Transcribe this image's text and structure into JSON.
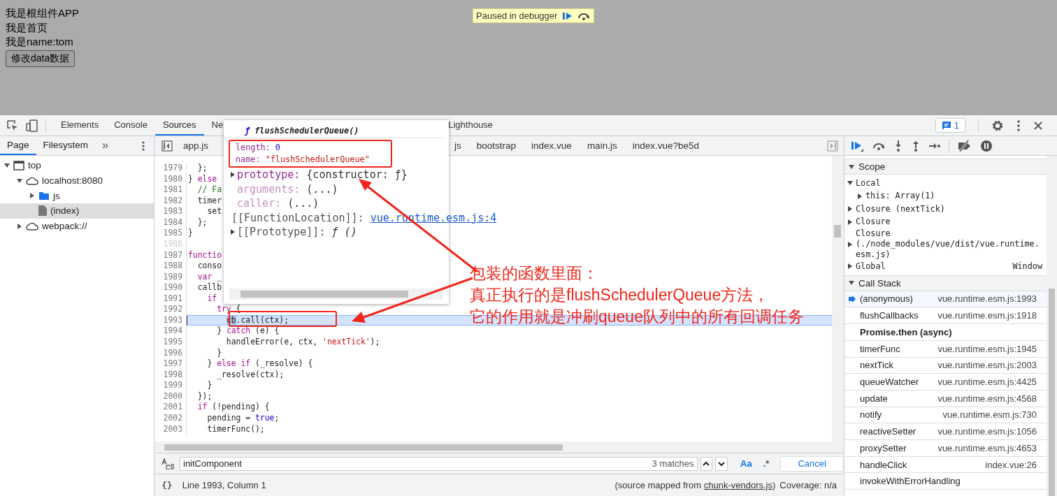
{
  "page": {
    "lines": [
      "我是根组件APP",
      "我是首页",
      "我是name:tom"
    ],
    "button": "修改data数据",
    "paused_badge": "Paused in debugger"
  },
  "devtools": {
    "tabs": [
      {
        "label": "Elements",
        "selected": false
      },
      {
        "label": "Console",
        "selected": false
      },
      {
        "label": "Sources",
        "selected": true
      },
      {
        "label": "Ne",
        "selected": false
      },
      {
        "label": "Lighthouse",
        "selected": false
      }
    ],
    "issues_count": "1",
    "navigator": {
      "tabs": [
        {
          "label": "Page",
          "selected": true
        },
        {
          "label": "Filesystem",
          "selected": false
        }
      ],
      "more": "»",
      "tree": [
        {
          "label": "top",
          "kind": "frame",
          "expanded": true,
          "selected": false,
          "children": [
            {
              "label": "localhost:8080",
              "kind": "cloud",
              "expanded": true,
              "selected": false,
              "children": [
                {
                  "label": "js",
                  "kind": "folder",
                  "expanded": false,
                  "selected": false
                },
                {
                  "label": "(index)",
                  "kind": "file",
                  "selected": true
                }
              ]
            },
            {
              "label": "webpack://",
              "kind": "cloud",
              "expanded": false,
              "selected": false
            }
          ]
        }
      ]
    },
    "file_tabs": [
      {
        "label": "app.js"
      },
      {
        "label": "js"
      },
      {
        "label": "bootstrap"
      },
      {
        "label": "index.vue"
      },
      {
        "label": "main.js"
      },
      {
        "label": "index.vue?be5d"
      }
    ],
    "code": [
      {
        "number": "1979",
        "paused": false,
        "tokens": [
          {
            "text": "  };",
            "kind": "plain"
          }
        ]
      },
      {
        "number": "1980",
        "paused": false,
        "tokens": [
          {
            "text": "} ",
            "kind": "plain"
          },
          {
            "text": "else",
            "kind": "keyword"
          }
        ]
      },
      {
        "number": "1981",
        "paused": false,
        "tokens": [
          {
            "text": "  // Fa",
            "kind": "comment"
          }
        ]
      },
      {
        "number": "1982",
        "paused": false,
        "tokens": [
          {
            "text": "  timer",
            "kind": "plain"
          }
        ]
      },
      {
        "number": "1983",
        "paused": false,
        "tokens": [
          {
            "text": "    set",
            "kind": "plain"
          }
        ]
      },
      {
        "number": "1984",
        "paused": false,
        "tokens": [
          {
            "text": "  };",
            "kind": "plain"
          }
        ]
      },
      {
        "number": "1985",
        "paused": false,
        "tokens": [
          {
            "text": "}",
            "kind": "plain"
          }
        ]
      },
      {
        "number": "1986",
        "paused": false
      },
      {
        "number": "1987",
        "paused": false,
        "tokens": [
          {
            "text": "functio",
            "kind": "keyword"
          }
        ]
      },
      {
        "number": "1988",
        "paused": false,
        "tokens": [
          {
            "text": "  conso",
            "kind": "plain"
          }
        ]
      },
      {
        "number": "1989",
        "paused": false,
        "tokens": [
          {
            "text": "  var",
            "kind": "keyword"
          },
          {
            "text": " _",
            "kind": "plain"
          }
        ]
      },
      {
        "number": "1990",
        "paused": false,
        "tokens": [
          {
            "text": "  callb",
            "kind": "plain"
          }
        ]
      },
      {
        "number": "1991",
        "paused": false,
        "tokens": [
          {
            "text": "    if",
            "kind": "keyword"
          }
        ]
      },
      {
        "number": "1992",
        "paused": false,
        "tokens": [
          {
            "text": "      try",
            "kind": "keyword"
          },
          {
            "text": " {",
            "kind": "plain"
          }
        ]
      },
      {
        "number": "1993",
        "paused": true,
        "tokens": [
          {
            "text": "        cb",
            "kind": "selection"
          },
          {
            "text": ".call(ctx);",
            "kind": "plain"
          }
        ]
      },
      {
        "number": "1994",
        "paused": false,
        "tokens": [
          {
            "text": "      } ",
            "kind": "plain"
          },
          {
            "text": "catch",
            "kind": "keyword"
          },
          {
            "text": " (e) {",
            "kind": "plain"
          }
        ]
      },
      {
        "number": "1995",
        "paused": false,
        "tokens": [
          {
            "text": "        handleError(e, ctx, ",
            "kind": "plain"
          },
          {
            "text": "'nextTick'",
            "kind": "string"
          },
          {
            "text": ");",
            "kind": "plain"
          }
        ]
      },
      {
        "number": "1996",
        "paused": false,
        "tokens": [
          {
            "text": "      }",
            "kind": "plain"
          }
        ]
      },
      {
        "number": "1997",
        "paused": false,
        "tokens": [
          {
            "text": "    } ",
            "kind": "plain"
          },
          {
            "text": "else if",
            "kind": "keyword"
          },
          {
            "text": " (_resolve) {",
            "kind": "plain"
          }
        ]
      },
      {
        "number": "1998",
        "paused": false,
        "tokens": [
          {
            "text": "      _resolve(ctx);",
            "kind": "plain"
          }
        ]
      },
      {
        "number": "1999",
        "paused": false,
        "tokens": [
          {
            "text": "    }",
            "kind": "plain"
          }
        ]
      },
      {
        "number": "2000",
        "paused": false,
        "tokens": [
          {
            "text": "  });",
            "kind": "plain"
          }
        ]
      },
      {
        "number": "2001",
        "paused": false,
        "tokens": [
          {
            "text": "  if",
            "kind": "keyword"
          },
          {
            "text": " (!pending) {",
            "kind": "plain"
          }
        ]
      },
      {
        "number": "2002",
        "paused": false,
        "tokens": [
          {
            "text": "    pending = ",
            "kind": "plain"
          },
          {
            "text": "true",
            "kind": "literal"
          },
          {
            "text": ";",
            "kind": "plain"
          }
        ]
      },
      {
        "number": "2003",
        "paused": false,
        "tokens": [
          {
            "text": "    timerFunc();",
            "kind": "plain"
          }
        ]
      }
    ],
    "popover": {
      "sign": "ƒ",
      "title": "flushSchedulerQueue()",
      "marked_properties": [
        {
          "key": "length:",
          "value": "0",
          "kind": "number"
        },
        {
          "key": "name:",
          "value": "\"flushSchedulerQueue\"",
          "kind": "string"
        }
      ],
      "properties": [
        {
          "key": "prototype:",
          "value": "{constructor: ƒ}",
          "kind": "object",
          "dim": false,
          "expandable": true
        },
        {
          "key": "arguments:",
          "value": "(...)",
          "kind": "object",
          "dim": true,
          "expandable": false
        },
        {
          "key": "caller:",
          "value": "(...)",
          "kind": "object",
          "dim": true,
          "expandable": false
        },
        {
          "key": "[[FunctionLocation]]:",
          "value": "vue.runtime.esm.js:4",
          "kind": "link",
          "dim": false,
          "expandable": false
        },
        {
          "key": "[[Prototype]]:",
          "value": "ƒ ()",
          "kind": "function",
          "dim": false,
          "expandable": true
        }
      ]
    },
    "search": {
      "value": "initComponent",
      "matches": "3 matches",
      "case_button": "Aa",
      "regex_button": ".*",
      "cancel": "Cancel"
    },
    "status": {
      "format_button": "{}",
      "position": "Line 1993, Column 1",
      "source_prefix": "(source mapped from ",
      "source_link": "chunk-vendors.js",
      "source_suffix": ")",
      "coverage": "Coverage: n/a"
    },
    "scope": {
      "title": "Scope",
      "expanded": true,
      "items": [
        {
          "label": "Local",
          "expanded": true,
          "children": [
            {
              "label": "this: Array(1)",
              "expanded": false
            }
          ]
        },
        {
          "label": "Closure (nextTick)",
          "expanded": false
        },
        {
          "label": "Closure",
          "expanded": false
        },
        {
          "label": "Closure (./node_modules/vue/dist/vue.runtime.esm.js)",
          "expanded": false
        },
        {
          "label": "Global",
          "value": "Window",
          "expanded": false
        }
      ]
    },
    "call_stack": {
      "title": "Call Stack",
      "expanded": true,
      "frames": [
        {
          "kind": "frame",
          "name": "(anonymous)",
          "location": "vue.runtime.esm.js:1993",
          "selected": true
        },
        {
          "kind": "frame",
          "name": "flushCallbacks",
          "location": "vue.runtime.esm.js:1918",
          "selected": false
        },
        {
          "kind": "async",
          "name": "Promise.then (async)"
        },
        {
          "kind": "frame",
          "name": "timerFunc",
          "location": "vue.runtime.esm.js:1945",
          "selected": false
        },
        {
          "kind": "frame",
          "name": "nextTick",
          "location": "vue.runtime.esm.js:2003",
          "selected": false
        },
        {
          "kind": "frame",
          "name": "queueWatcher",
          "location": "vue.runtime.esm.js:4425",
          "selected": false
        },
        {
          "kind": "frame",
          "name": "update",
          "location": "vue.runtime.esm.js:4568",
          "selected": false
        },
        {
          "kind": "frame",
          "name": "notify",
          "location": "vue.runtime.esm.js:730",
          "selected": false
        },
        {
          "kind": "frame",
          "name": "reactiveSetter",
          "location": "vue.runtime.esm.js:1056",
          "selected": false
        },
        {
          "kind": "frame",
          "name": "proxySetter",
          "location": "vue.runtime.esm.js:4653",
          "selected": false
        },
        {
          "kind": "frame",
          "name": "handleClick",
          "location": "index.vue:26",
          "selected": false
        },
        {
          "kind": "frame",
          "name": "invokeWithErrorHandling",
          "selected": false
        }
      ]
    }
  },
  "annotation": {
    "lines": [
      "包装的函数里面：",
      "真正执行的是flushSchedulerQueue方法，",
      "它的作用就是冲刷queue队列中的所有回调任务"
    ]
  }
}
